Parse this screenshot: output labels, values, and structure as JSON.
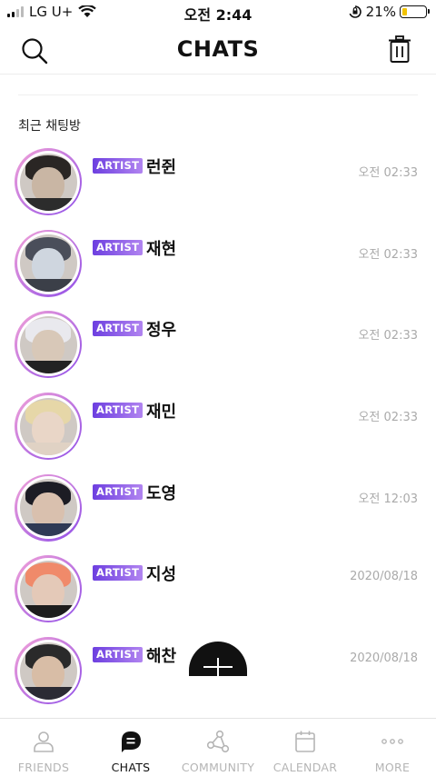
{
  "status_bar": {
    "carrier": "LG U+",
    "time": "오전 2:44",
    "battery_percent": "21%",
    "battery_level": 0.21,
    "battery_color": "#f2c300"
  },
  "header": {
    "title": "CHATS",
    "left_icon": "search-icon",
    "right_icon": "trash-icon"
  },
  "section_title": "최근 채팅방",
  "chats": [
    {
      "badge": "ARTIST",
      "name": "런쥔",
      "time": "오전 02:33"
    },
    {
      "badge": "ARTIST",
      "name": "재현",
      "time": "오전 02:33"
    },
    {
      "badge": "ARTIST",
      "name": "정우",
      "time": "오전 02:33"
    },
    {
      "badge": "ARTIST",
      "name": "재민",
      "time": "오전 02:33"
    },
    {
      "badge": "ARTIST",
      "name": "도영",
      "time": "오전 12:03"
    },
    {
      "badge": "ARTIST",
      "name": "지성",
      "time": "2020/08/18"
    },
    {
      "badge": "ARTIST",
      "name": "해찬",
      "time": "2020/08/18"
    }
  ],
  "tabs": [
    {
      "label": "FRIENDS",
      "icon": "person-icon",
      "active": false
    },
    {
      "label": "CHATS",
      "icon": "chat-bubble-icon",
      "active": true
    },
    {
      "label": "COMMUNITY",
      "icon": "share-nodes-icon",
      "active": false
    },
    {
      "label": "CALENDAR",
      "icon": "calendar-icon",
      "active": false
    },
    {
      "label": "MORE",
      "icon": "more-dots-icon",
      "active": false
    }
  ],
  "colors": {
    "badge_gradient_start": "#6d3fe0",
    "badge_gradient_end": "#b184f0",
    "avatar_ring_start": "#f3a3d8",
    "avatar_ring_end": "#8f4de8",
    "tab_inactive": "#b5b5b5",
    "tab_active": "#111111"
  }
}
